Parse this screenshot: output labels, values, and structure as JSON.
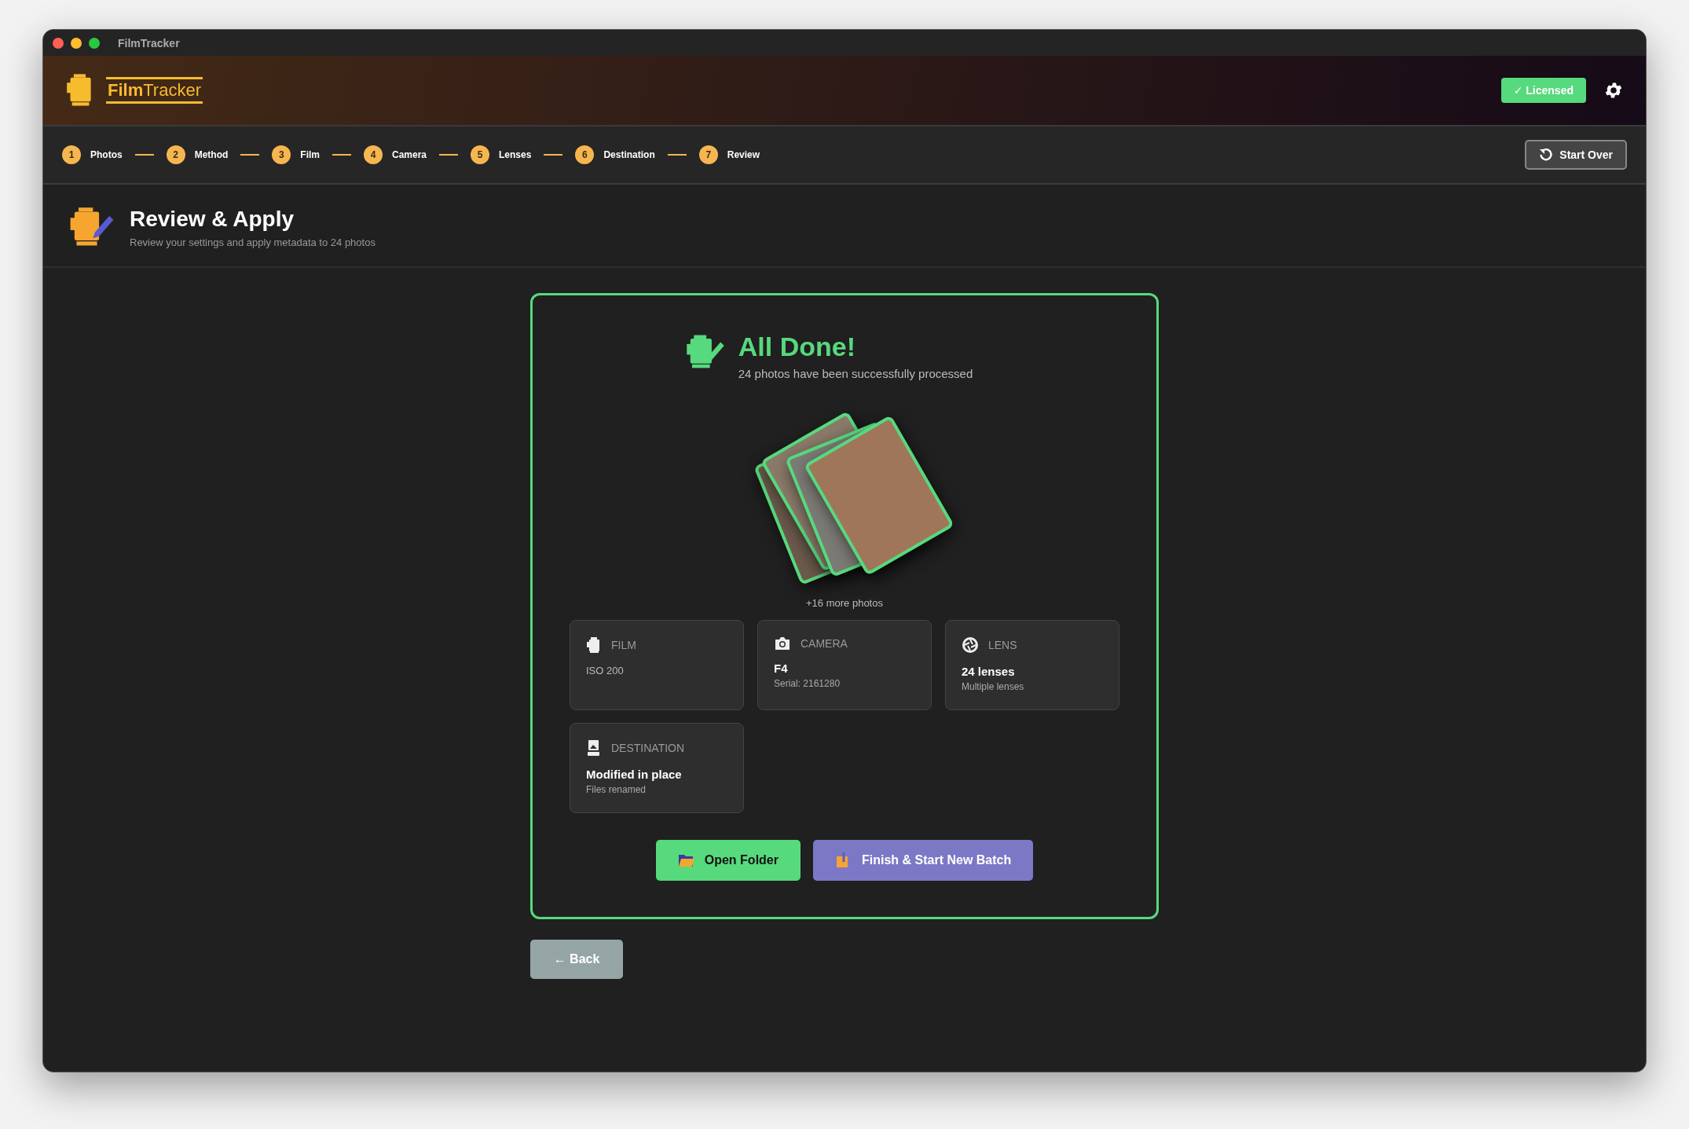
{
  "window": {
    "title": "FilmTracker"
  },
  "header": {
    "logo": "**Film**Tracker",
    "license_badge": "✓ Licensed"
  },
  "steps": [
    {
      "number": "1",
      "label": "Photos"
    },
    {
      "number": "2",
      "label": "Method"
    },
    {
      "number": "3",
      "label": "Film"
    },
    {
      "number": "4",
      "label": "Camera"
    },
    {
      "number": "5",
      "label": "Lenses"
    },
    {
      "number": "6",
      "label": "Destination"
    },
    {
      "number": "7",
      "label": "Review"
    }
  ],
  "start_over": "Start Over",
  "page": {
    "title": "Review & Apply",
    "subtitle": "Review your settings and apply metadata to 24 photos"
  },
  "result": {
    "title": "All Done!",
    "message": "24 photos have been successfully processed",
    "more_photos": "+16 more photos",
    "summary": [
      {
        "kind": "film",
        "label": "FILM",
        "detail": "ISO 200"
      },
      {
        "kind": "camera",
        "label": "CAMERA",
        "value": "F4",
        "detail": "Serial: 2161280"
      },
      {
        "kind": "lens",
        "label": "LENS",
        "value": "24 lenses",
        "detail": "Multiple lenses"
      },
      {
        "kind": "destination",
        "label": "DESTINATION",
        "value": "Modified in place",
        "detail": "Files renamed"
      }
    ],
    "actions": [
      {
        "kind": "open",
        "label": "Open Folder"
      },
      {
        "kind": "finish",
        "label": "Finish & Start New Batch"
      }
    ]
  },
  "back": "← Back"
}
